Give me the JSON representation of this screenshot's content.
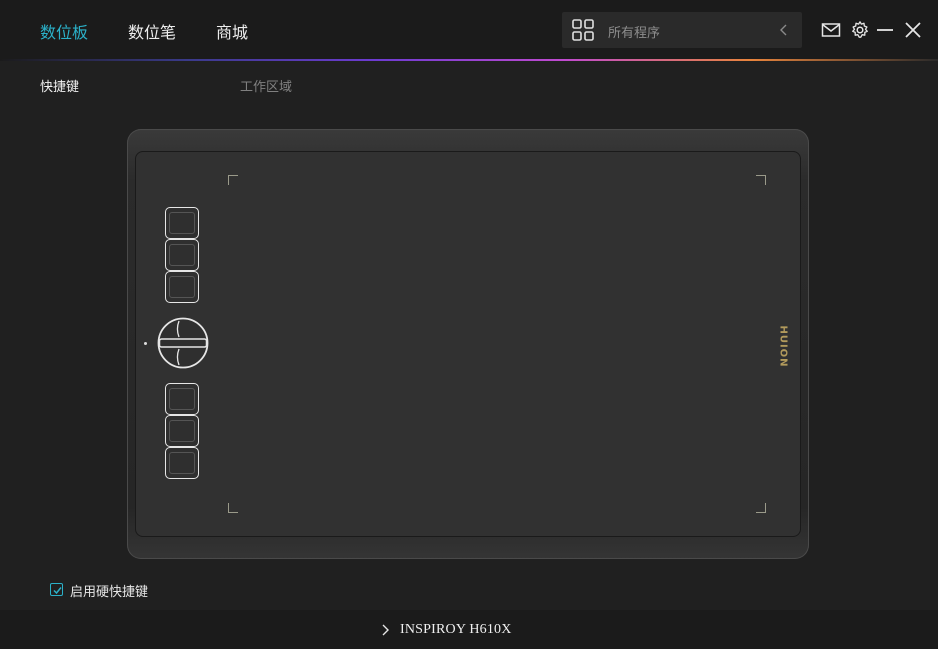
{
  "nav": {
    "tabs": [
      {
        "label": "数位板",
        "active": true
      },
      {
        "label": "数位笔",
        "active": false
      },
      {
        "label": "商城",
        "active": false
      }
    ]
  },
  "program_select": {
    "value": "所有程序",
    "icon": "grid-icon"
  },
  "window_controls": {
    "icons": [
      "mail-icon",
      "gear-icon",
      "minimize-icon",
      "close-icon"
    ]
  },
  "subtabs": [
    {
      "label": "快捷键",
      "active": true
    },
    {
      "label": "工作区域",
      "active": false
    }
  ],
  "tablet": {
    "brand": "HUION",
    "upper_keys": 3,
    "lower_keys": 3
  },
  "hotkeys_toggle": {
    "label": "启用硬快捷键",
    "checked": true
  },
  "footer": {
    "device_name": "INSPIROY H610X"
  },
  "colors": {
    "accent": "#2bb1c9",
    "background": "#202020",
    "bar": "#1b1b1b",
    "logo": "#b29a5c"
  }
}
